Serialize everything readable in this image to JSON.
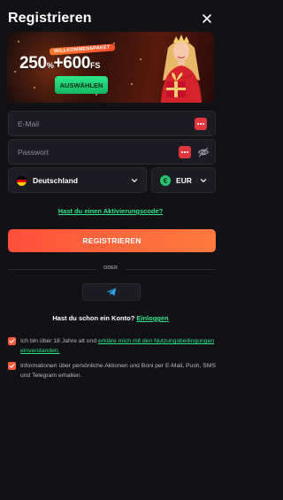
{
  "header": {
    "title": "Registrieren",
    "close_icon": "close-icon"
  },
  "banner": {
    "tag": "WILLKOMMENSPAKET",
    "amount_percent": "250",
    "percent_sign": "%",
    "plus_spins": "+600",
    "spins_unit": "FS",
    "select_label": "AUSWÄHLEN"
  },
  "form": {
    "email_placeholder": "E-Mail",
    "password_placeholder": "Passwort",
    "country_value": "Deutschland",
    "currency_value": "EUR",
    "currency_symbol": "€",
    "promo_code_link": "Hast du einen Aktivierungscode?",
    "register_label": "REGISTRIEREN",
    "or_label": "ODER"
  },
  "login": {
    "prompt": "Hast du schon ein Konto?",
    "link": "Einloggen"
  },
  "consents": [
    {
      "text": "Ich bin über 18 Jahre alt und ",
      "link": "erkläre mich mit den Nutzungsbedingungen einverstanden.",
      "checked": true
    },
    {
      "text": "Informationen über persönliche Aktionen und Boni per E-Mail, Push, SMS und Telegram erhalten.",
      "checked": true
    }
  ],
  "colors": {
    "background": "#121216",
    "accent_green": "#2ee68a",
    "accent_orange": "#ff5a3a",
    "field_bg": "#1c1c22"
  }
}
